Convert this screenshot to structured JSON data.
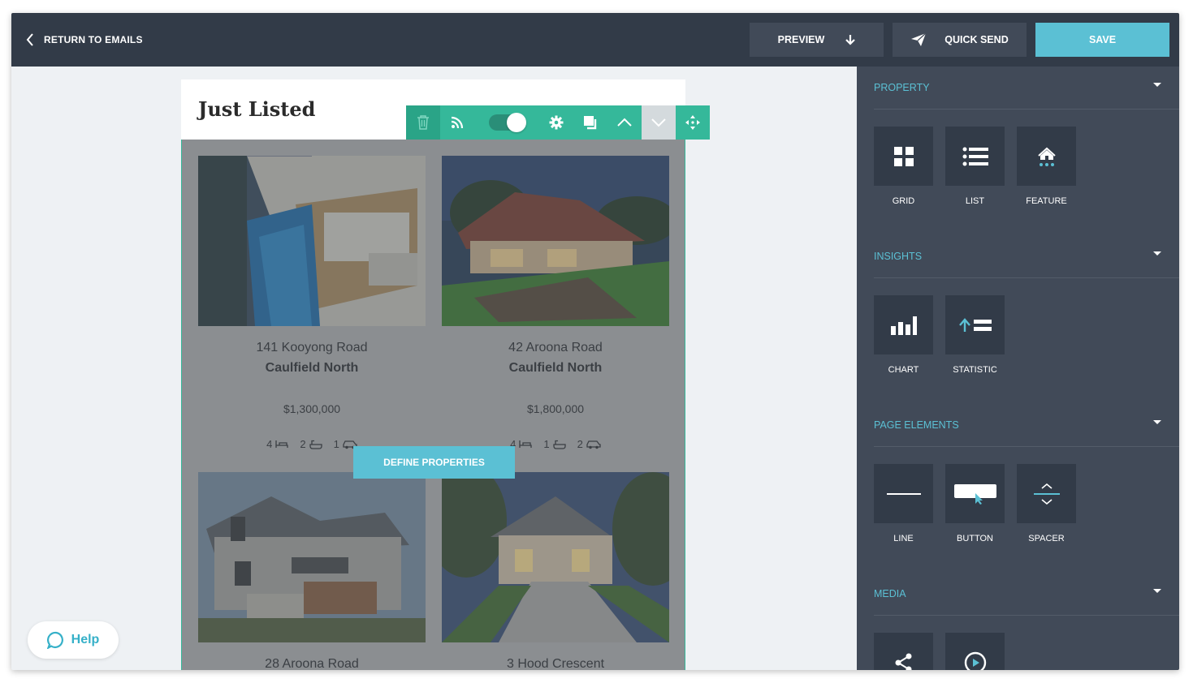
{
  "topbar": {
    "back_label": "RETURN TO EMAILS",
    "preview_label": "PREVIEW",
    "quick_send_label": "QUICK SEND",
    "save_label": "SAVE"
  },
  "email": {
    "title": "Just Listed",
    "define_label": "DEFINE PROPERTIES",
    "listings": [
      {
        "street": "141 Kooyong Road",
        "suburb": "Caulfield North",
        "price": "$1,300,000",
        "beds": "4",
        "baths": "2",
        "cars": "1"
      },
      {
        "street": "42 Aroona Road",
        "suburb": "Caulfield North",
        "price": "$1,800,000",
        "beds": "4",
        "baths": "1",
        "cars": "2"
      },
      {
        "street": "28 Aroona Road"
      },
      {
        "street": "3 Hood Crescent"
      }
    ]
  },
  "panel": {
    "property": {
      "title": "PROPERTY",
      "tiles": [
        "GRID",
        "LIST",
        "FEATURE"
      ]
    },
    "insights": {
      "title": "INSIGHTS",
      "tiles": [
        "CHART",
        "STATISTIC"
      ]
    },
    "page_elements": {
      "title": "PAGE ELEMENTS",
      "tiles": [
        "LINE",
        "BUTTON",
        "SPACER"
      ]
    },
    "media": {
      "title": "MEDIA"
    }
  },
  "help_label": "Help",
  "colors": {
    "accent": "#5bc0d4",
    "toolbar_green": "#35b89a",
    "dark_bar": "#323b48",
    "panel": "#414a58"
  },
  "icons": [
    "chevron-left-icon",
    "arrow-down-icon",
    "paper-plane-icon",
    "trash-icon",
    "rss-icon",
    "gear-icon",
    "duplicate-icon",
    "chevron-up-icon",
    "chevron-down-icon",
    "move-icon",
    "bed-icon",
    "bath-icon",
    "car-icon",
    "grid-icon",
    "list-icon",
    "house-star-icon",
    "bar-chart-icon",
    "statistic-icon",
    "line-icon",
    "button-icon",
    "spacer-icon",
    "share-icon",
    "play-icon",
    "chat-bubble-icon"
  ]
}
